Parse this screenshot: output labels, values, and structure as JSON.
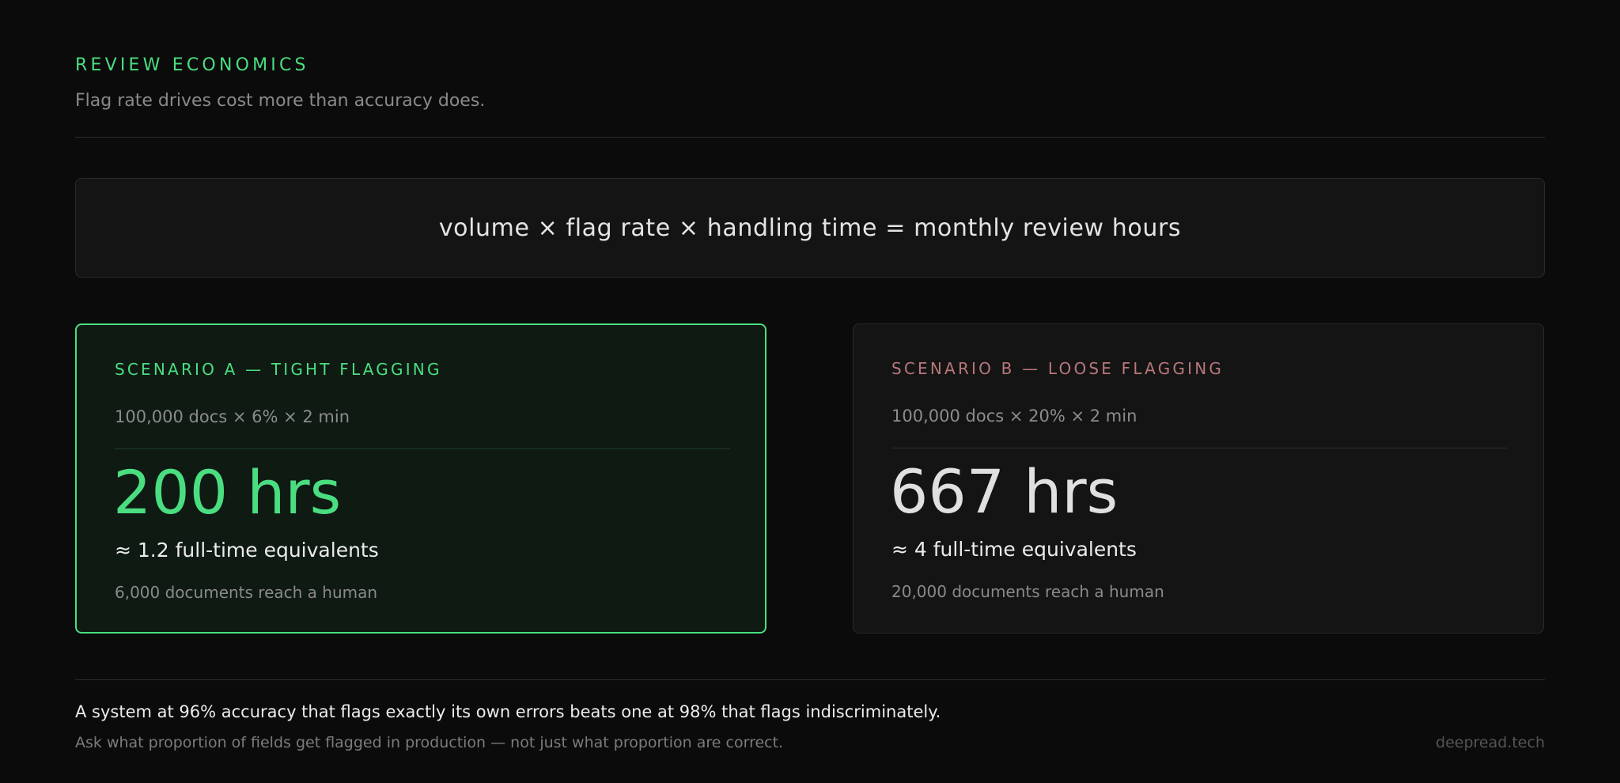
{
  "header": {
    "eyebrow": "REVIEW ECONOMICS",
    "subtitle": "Flag rate drives cost more than accuracy does."
  },
  "formula": "volume × flag rate × handling time = monthly review hours",
  "scenarios": [
    {
      "label": "SCENARIO A — TIGHT FLAGGING",
      "calc": "100,000 docs × 6% × 2 min",
      "hours": "200 hrs",
      "fte": "≈ 1.2 full-time equivalents",
      "docs": "6,000 documents reach a human"
    },
    {
      "label": "SCENARIO B — LOOSE FLAGGING",
      "calc": "100,000 docs × 20% × 2 min",
      "hours": "667 hrs",
      "fte": "≈ 4 full-time equivalents",
      "docs": "20,000 documents reach a human"
    }
  ],
  "footer": {
    "conclusion": "A system at 96% accuracy that flags exactly its own errors beats one at 98% that flags indiscriminately.",
    "advice": "Ask what proportion of fields get flagged in production — not just what proportion are correct.",
    "brand": "deepread.tech"
  },
  "colors": {
    "background": "#0b0b0b",
    "accent_green": "#4ade80",
    "accent_muted_red": "#b9777a",
    "text_primary": "#ececec",
    "text_muted": "#8a8a8a"
  }
}
